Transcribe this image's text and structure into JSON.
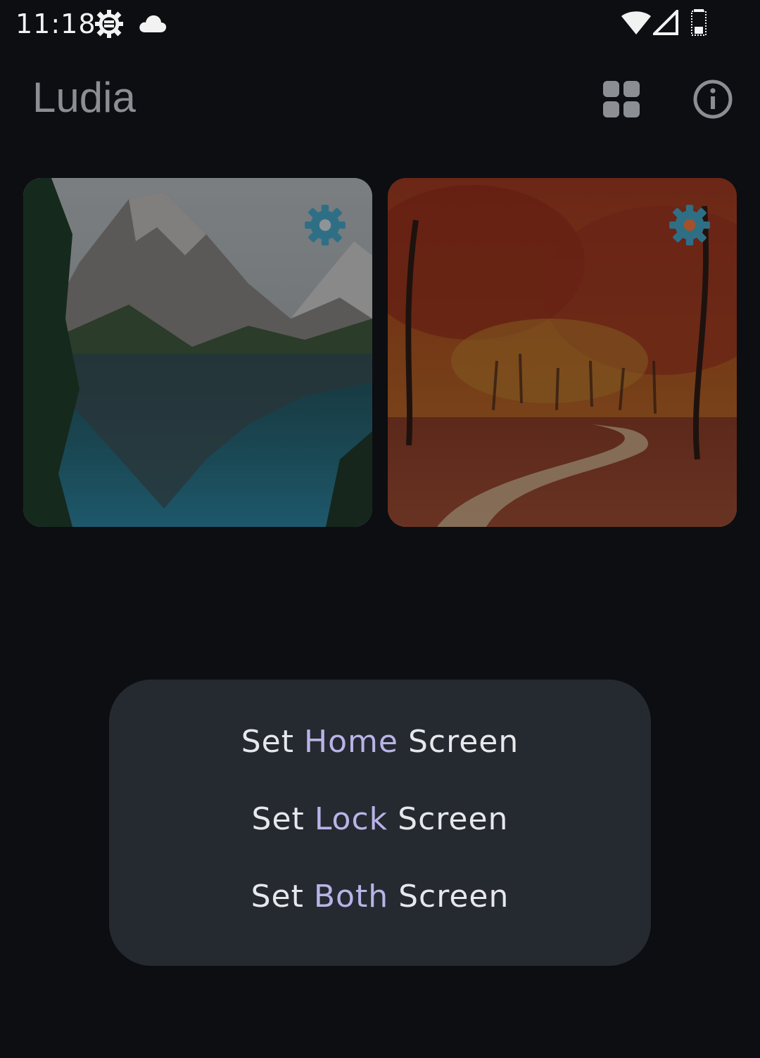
{
  "status_bar": {
    "time": "11:18",
    "left_icons": [
      "settings-gear-icon",
      "cloud-icon"
    ],
    "right_icons": [
      "wifi-icon",
      "cell-signal-icon",
      "battery-icon"
    ]
  },
  "app_bar": {
    "title": "Ludia",
    "actions": [
      "grid-view-icon",
      "info-icon"
    ]
  },
  "wallpapers": [
    {
      "subject": "mountain lake",
      "action_icon": "settings-gear-icon"
    },
    {
      "subject": "autumn forest path",
      "action_icon": "settings-gear-icon"
    }
  ],
  "dialog": {
    "options": [
      {
        "prefix": "Set",
        "highlight": "Home",
        "suffix": "Screen"
      },
      {
        "prefix": "Set",
        "highlight": "Lock",
        "suffix": "Screen"
      },
      {
        "prefix": "Set",
        "highlight": "Both",
        "suffix": "Screen"
      }
    ]
  },
  "colors": {
    "background": "#0c0e12",
    "dialog_background": "#252a30",
    "highlight_text": "#b8b4e8",
    "gear_icon": "#2f6f86"
  }
}
